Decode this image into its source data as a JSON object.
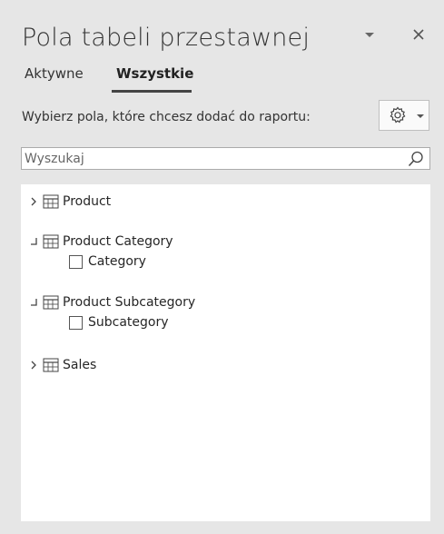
{
  "pane": {
    "title": "Pola tabeli przestawnej"
  },
  "tabs": [
    {
      "label": "Aktywne",
      "active": false
    },
    {
      "label": "Wszystkie",
      "active": true
    }
  ],
  "prompt": "Wybierz pola, które chcesz dodać do raportu:",
  "search": {
    "placeholder": "Wyszukaj",
    "value": ""
  },
  "tables": [
    {
      "name": "Product",
      "expanded": false,
      "fields": []
    },
    {
      "name": "Product Category",
      "expanded": true,
      "fields": [
        {
          "name": "Category",
          "checked": false
        }
      ]
    },
    {
      "name": "Product Subcategory",
      "expanded": true,
      "fields": [
        {
          "name": "Subcategory",
          "checked": false
        }
      ]
    },
    {
      "name": "Sales",
      "expanded": false,
      "fields": []
    }
  ],
  "icons": {
    "dropdown": "chevron-down-icon",
    "close": "close-icon",
    "settings": "gear-icon",
    "search": "search-icon",
    "table": "table-icon",
    "collapsed": "chevron-right-icon",
    "expanded": "expanded-bracket-icon"
  },
  "colors": {
    "pane_background": "#e6e6e6",
    "list_background": "#ffffff",
    "text": "#262626",
    "tab_underline": "#444444"
  }
}
